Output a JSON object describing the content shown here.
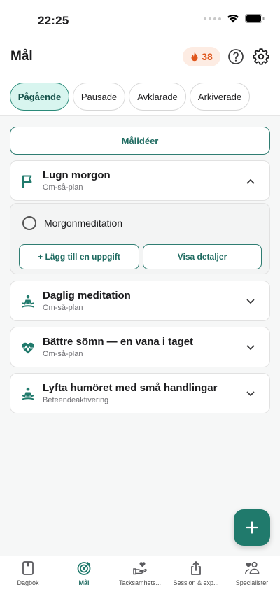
{
  "status_bar": {
    "time": "22:25"
  },
  "header": {
    "title": "Mål",
    "streak_count": "38"
  },
  "tabs": [
    {
      "label": "Pågående",
      "active": true
    },
    {
      "label": "Pausade",
      "active": false
    },
    {
      "label": "Avklarade",
      "active": false
    },
    {
      "label": "Arkiverade",
      "active": false
    }
  ],
  "ideas_button": {
    "label": "Målidéer"
  },
  "goals": [
    {
      "title": "Lugn morgon",
      "subtitle": "Om-så-plan",
      "icon": "flag-icon",
      "expanded": true
    },
    {
      "title": "Daglig meditation",
      "subtitle": "Om-så-plan",
      "icon": "meditation-icon",
      "expanded": false
    },
    {
      "title": "Bättre sömn — en vana i taget",
      "subtitle": "Om-så-plan",
      "icon": "heart-pulse-icon",
      "expanded": false
    },
    {
      "title": "Lyfta humöret med små handlingar",
      "subtitle": "Beteendeaktivering",
      "icon": "meditation-icon",
      "expanded": false
    }
  ],
  "expanded_goal": {
    "task_label": "Morgonmeditation",
    "add_task_label": "+ Lägg till en uppgift",
    "details_label": "Visa detaljer"
  },
  "tabbar": [
    {
      "label": "Dagbok",
      "icon": "book-icon",
      "active": false
    },
    {
      "label": "Mål",
      "icon": "target-icon",
      "active": true
    },
    {
      "label": "Tacksamhets...",
      "icon": "hand-heart-icon",
      "active": false
    },
    {
      "label": "Session & exp...",
      "icon": "share-icon",
      "active": false
    },
    {
      "label": "Specialister",
      "icon": "people-heart-icon",
      "active": false
    }
  ],
  "colors": {
    "accent": "#207a6c",
    "accent_light": "#d8f5ef",
    "streak": "#e0561c",
    "streak_bg": "#fdece3"
  }
}
